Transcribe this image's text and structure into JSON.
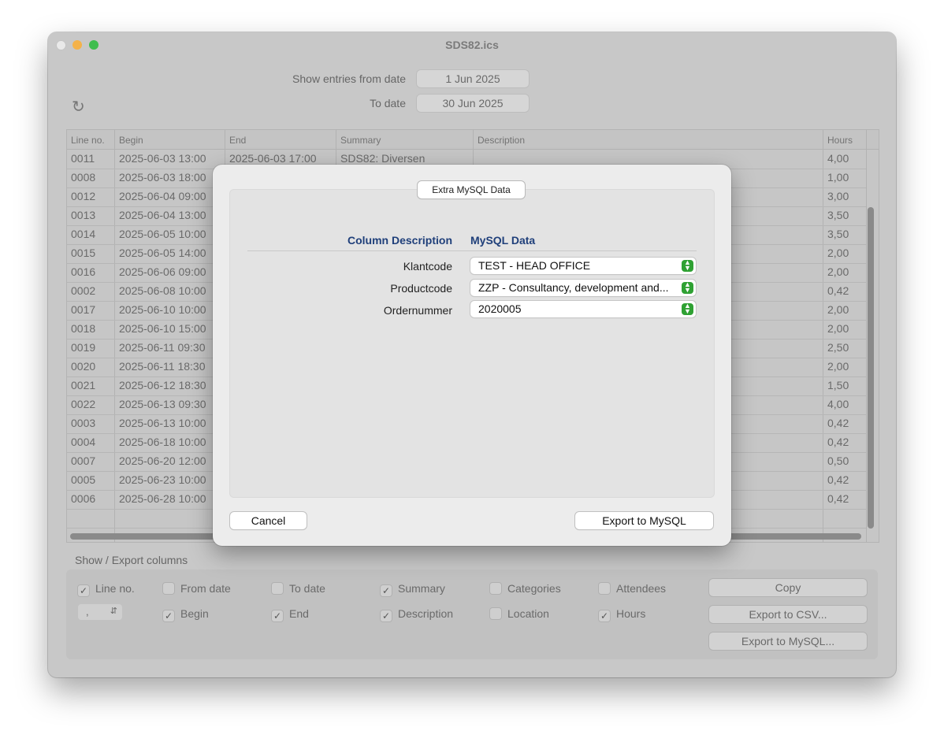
{
  "window": {
    "title": "SDS82.ics"
  },
  "filter": {
    "from_label": "Show entries from date",
    "from_value": "1 Jun 2025",
    "to_label": "To date",
    "to_value": "30 Jun 2025",
    "refresh_icon": "refresh-icon"
  },
  "table": {
    "headers": [
      "Line no.",
      "Begin",
      "End",
      "Summary",
      "Description",
      "Hours"
    ],
    "rows": [
      {
        "line": "0011",
        "begin": "2025-06-03 13:00",
        "end": "2025-06-03 17:00",
        "summary": "SDS82: Diversen",
        "hours": "4,00"
      },
      {
        "line": "0008",
        "begin": "2025-06-03 18:00",
        "hours": "1,00"
      },
      {
        "line": "0012",
        "begin": "2025-06-04 09:00",
        "hours": "3,00"
      },
      {
        "line": "0013",
        "begin": "2025-06-04 13:00",
        "hours": "3,50"
      },
      {
        "line": "0014",
        "begin": "2025-06-05 10:00",
        "hours": "3,50"
      },
      {
        "line": "0015",
        "begin": "2025-06-05 14:00",
        "hours": "2,00"
      },
      {
        "line": "0016",
        "begin": "2025-06-06 09:00",
        "hours": "2,00"
      },
      {
        "line": "0002",
        "begin": "2025-06-08 10:00",
        "hours": "0,42"
      },
      {
        "line": "0017",
        "begin": "2025-06-10 10:00",
        "hours": "2,00"
      },
      {
        "line": "0018",
        "begin": "2025-06-10 15:00",
        "hours": "2,00"
      },
      {
        "line": "0019",
        "begin": "2025-06-11 09:30",
        "hours": "2,50"
      },
      {
        "line": "0020",
        "begin": "2025-06-11 18:30",
        "hours": "2,00"
      },
      {
        "line": "0021",
        "begin": "2025-06-12 18:30",
        "hours": "1,50"
      },
      {
        "line": "0022",
        "begin": "2025-06-13 09:30",
        "hours": "4,00"
      },
      {
        "line": "0003",
        "begin": "2025-06-13 10:00",
        "hours": "0,42"
      },
      {
        "line": "0004",
        "begin": "2025-06-18 10:00",
        "hours": "0,42"
      },
      {
        "line": "0007",
        "begin": "2025-06-20 12:00",
        "hours": "0,50"
      },
      {
        "line": "0005",
        "begin": "2025-06-23 10:00",
        "hours": "0,42"
      },
      {
        "line": "0006",
        "begin": "2025-06-28 10:00",
        "hours": "0,42"
      }
    ]
  },
  "export": {
    "section_label": "Show / Export columns",
    "separator_value": ",",
    "checkboxes": [
      {
        "label": "Line no.",
        "checked": true
      },
      {
        "label": "From date",
        "checked": false
      },
      {
        "label": "To date",
        "checked": false
      },
      {
        "label": "Summary",
        "checked": true
      },
      {
        "label": "Categories",
        "checked": false
      },
      {
        "label": "Attendees",
        "checked": false
      },
      {
        "label": "Begin",
        "checked": true
      },
      {
        "label": "End",
        "checked": true
      },
      {
        "label": "Description",
        "checked": true
      },
      {
        "label": "Location",
        "checked": false
      },
      {
        "label": "Hours",
        "checked": true
      }
    ],
    "copy_label": "Copy",
    "csv_label": "Export to CSV...",
    "mysql_label": "Export to MySQL..."
  },
  "modal": {
    "tab_label": "Extra MySQL Data",
    "col_header": "Column Description",
    "data_header": "MySQL Data",
    "fields": [
      {
        "label": "Klantcode",
        "value": "TEST - HEAD OFFICE"
      },
      {
        "label": "Productcode",
        "value": "ZZP - Consultancy, development and..."
      },
      {
        "label": "Ordernummer",
        "value": "2020005"
      }
    ],
    "cancel_label": "Cancel",
    "export_label": "Export to MySQL"
  }
}
